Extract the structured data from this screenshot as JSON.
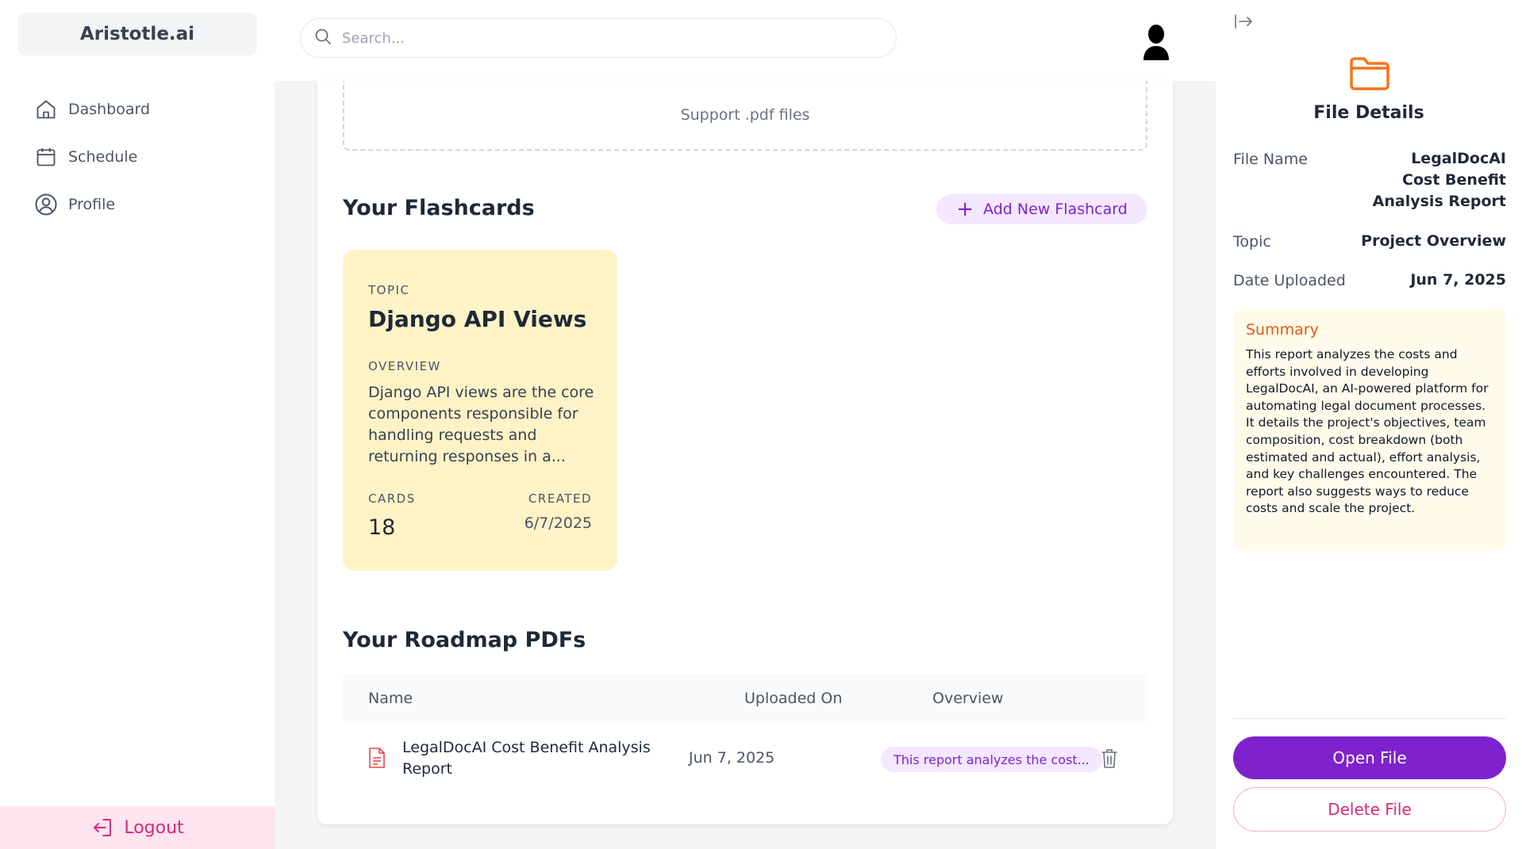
{
  "app": {
    "brand": "Aristotle.ai"
  },
  "sidebar": {
    "items": [
      {
        "label": "Dashboard",
        "icon": "home-icon"
      },
      {
        "label": "Schedule",
        "icon": "calendar-icon"
      },
      {
        "label": "Profile",
        "icon": "user-circle-icon"
      }
    ],
    "logout_label": "Logout"
  },
  "search": {
    "placeholder": "Search...",
    "value": ""
  },
  "upload": {
    "hint": "Support .pdf files"
  },
  "flashcards": {
    "title": "Your Flashcards",
    "add_label": "Add New Flashcard",
    "items": [
      {
        "topic_label": "TOPIC",
        "topic": "Django API Views",
        "overview_label": "OVERVIEW",
        "overview": "Django API views are the core components responsible for handling requests and returning responses in a...",
        "cards_label": "CARDS",
        "cards": "18",
        "created_label": "CREATED",
        "created": "6/7/2025"
      }
    ]
  },
  "roadmaps": {
    "title": "Your Roadmap PDFs",
    "columns": [
      "Name",
      "Uploaded On",
      "Overview"
    ],
    "rows": [
      {
        "name": "LegalDocAI Cost Benefit Analysis Report",
        "uploaded": "Jun 7, 2025",
        "overview": "This report analyzes the cost..."
      }
    ]
  },
  "details": {
    "title": "File Details",
    "file_name_label": "File Name",
    "file_name": "LegalDocAI Cost Benefit Analysis Report",
    "topic_label": "Topic",
    "topic": "Project Overview",
    "date_label": "Date Uploaded",
    "date": "Jun 7, 2025",
    "summary_label": "Summary",
    "summary": "This report analyzes the costs and efforts involved in developing LegalDocAI, an AI-powered platform for automating legal document processes.  It details the project's objectives, team composition, cost breakdown (both estimated and actual), effort analysis, and key challenges encountered.  The report also suggests ways to reduce costs and scale the project.",
    "open_label": "Open File",
    "delete_label": "Delete File"
  },
  "colors": {
    "accent": "#7e22ce",
    "accent_light": "#f3e8ff",
    "logout": "#db2777",
    "flashcard_bg": "#fef3c7",
    "summary_title": "#ea580c"
  }
}
